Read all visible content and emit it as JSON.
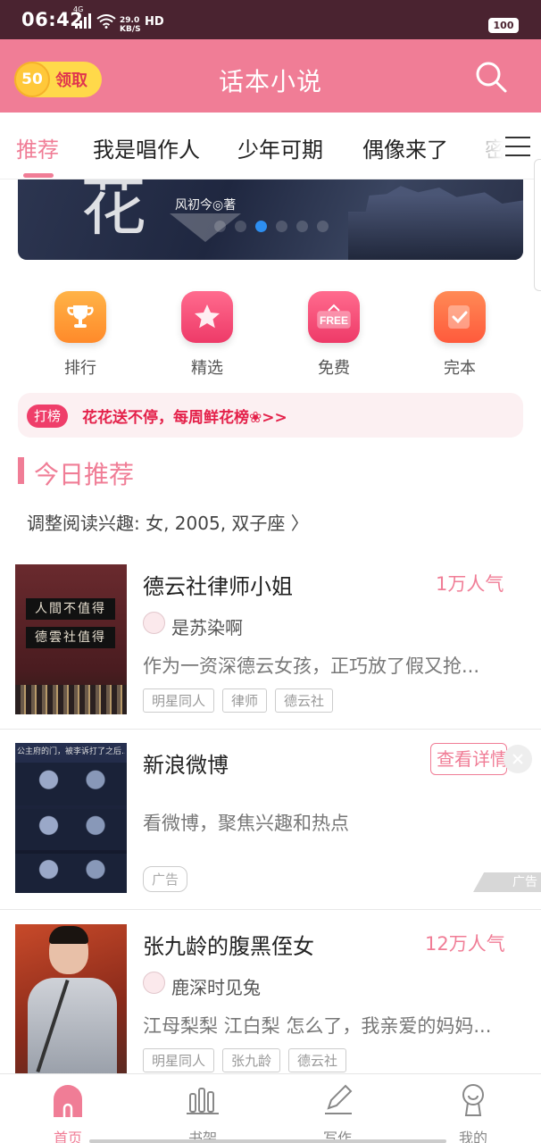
{
  "status_bar": {
    "time": "06:42",
    "network": "4G",
    "speed_value": "29.0",
    "speed_unit": "KB/S",
    "hd": "HD",
    "battery": "100"
  },
  "header": {
    "coin_amount": "50",
    "coin_label": "领取",
    "title": "话本小说",
    "search_icon": "search-icon",
    "accent_color": "#f07d96"
  },
  "tabs": [
    {
      "label": "推荐",
      "active": true
    },
    {
      "label": "我是唱作人",
      "active": false
    },
    {
      "label": "少年可期",
      "active": false
    },
    {
      "label": "偶像来了",
      "active": false
    },
    {
      "label": "密",
      "active": false
    }
  ],
  "banner": {
    "author_text": "风初今◎著",
    "slide_count": 6,
    "active_slide": 3
  },
  "categories": [
    {
      "label": "排行",
      "icon": "trophy-icon",
      "color": "#ff9a3c"
    },
    {
      "label": "精选",
      "icon": "star-icon",
      "color": "#f2456e"
    },
    {
      "label": "免费",
      "icon": "free-icon",
      "color": "#f2456e"
    },
    {
      "label": "完本",
      "icon": "checklist-icon",
      "color": "#ff6a3c"
    }
  ],
  "promo": {
    "tag": "打榜",
    "text": "花花送不停，每周鲜花榜❀>>"
  },
  "section": {
    "title": "今日推荐",
    "interest": "调整阅读兴趣: 女, 2005, 双子座 〉"
  },
  "books": [
    {
      "title": "德云社律师小姐",
      "popularity": "1万人气",
      "author": "是苏染啊",
      "description": "作为一资深德云女孩，正巧放了假又抢...",
      "tags": [
        "明星同人",
        "律师",
        "德云社"
      ],
      "cover_text_1": "人間不值得",
      "cover_text_2": "德雲社值得"
    },
    {
      "title": "新浪微博",
      "detail_button": "查看详情",
      "description": "看微博，聚焦兴趣和热点",
      "ad_tag": "广告",
      "ad_mark": "广告",
      "cover_caption": "公主府的门，被李诉打了之后..."
    },
    {
      "title": "张九龄的腹黑侄女",
      "popularity": "12万人气",
      "author": "鹿深时见兔",
      "description": "江母梨梨 江白梨 怎么了，我亲爱的妈妈...",
      "tags": [
        "明星同人",
        "张九龄",
        "德云社"
      ]
    }
  ],
  "bottom_nav": [
    {
      "label": "首页",
      "icon": "home-icon",
      "active": true
    },
    {
      "label": "书架",
      "icon": "bookshelf-icon",
      "active": false
    },
    {
      "label": "写作",
      "icon": "pencil-icon",
      "active": false
    },
    {
      "label": "我的",
      "icon": "profile-icon",
      "active": false
    }
  ]
}
